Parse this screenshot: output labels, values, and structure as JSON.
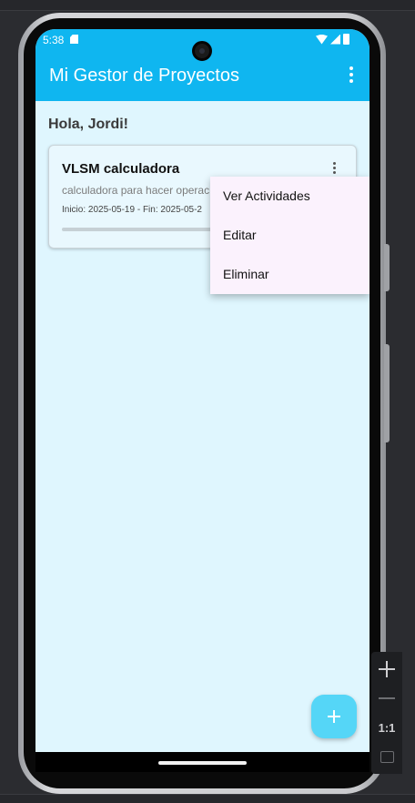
{
  "status_bar": {
    "time": "5:38"
  },
  "app_bar": {
    "title": "Mi Gestor de Proyectos"
  },
  "greeting": "Hola, Jordi!",
  "project_card": {
    "title": "VLSM calculadora",
    "description": "calculadora para hacer operac",
    "dates": "Inicio: 2025-05-19 - Fin: 2025-05-2",
    "progress": 0
  },
  "context_menu": {
    "items": [
      {
        "label": "Ver Actividades"
      },
      {
        "label": "Editar"
      },
      {
        "label": "Eliminar"
      }
    ]
  },
  "zoom_controls": {
    "ratio_label": "1:1"
  },
  "colors": {
    "primary": "#0fb6f0",
    "background": "#dff6fe",
    "fab": "#55d6f7",
    "menu": "#fbf2fd"
  }
}
